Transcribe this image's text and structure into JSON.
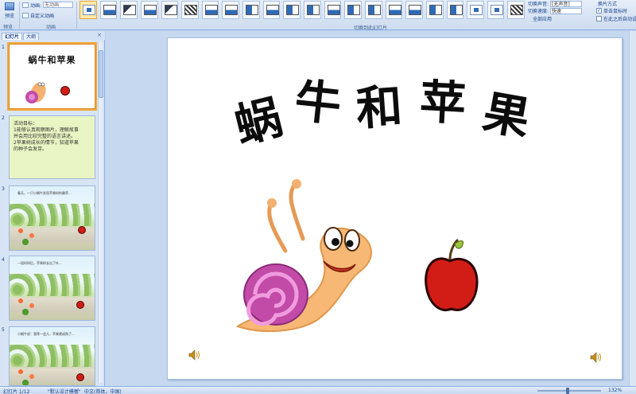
{
  "ribbon": {
    "preview_label": "预览",
    "group_preview": "预览",
    "animation": {
      "row1_label": "动画:",
      "row1_value": "无动画",
      "custom_label": "自定义动画",
      "group_label": "动画"
    },
    "transition_group_label": "切换到此幻灯片",
    "transitions": [
      {
        "name": "none"
      },
      {
        "name": "fade-smooth"
      },
      {
        "name": "fade-black"
      },
      {
        "name": "cut"
      },
      {
        "name": "cut-black"
      },
      {
        "name": "dissolve"
      },
      {
        "name": "wipe-down"
      },
      {
        "name": "wipe-left"
      },
      {
        "name": "wipe-right"
      },
      {
        "name": "wipe-up"
      },
      {
        "name": "split"
      },
      {
        "name": "split-vertical"
      },
      {
        "name": "reveal-down"
      },
      {
        "name": "reveal-left"
      },
      {
        "name": "reveal-right"
      },
      {
        "name": "reveal-up"
      },
      {
        "name": "cover-down"
      },
      {
        "name": "cover-left"
      },
      {
        "name": "cover-right"
      },
      {
        "name": "box-in"
      },
      {
        "name": "box-out"
      },
      {
        "name": "diamond"
      }
    ],
    "right": {
      "sound_label": "切换声音:",
      "sound_value": "[无声音]",
      "speed_label": "切换速度:",
      "speed_value": "快速",
      "apply_all": "全部应用",
      "advance_header": "换片方式",
      "on_click": "单击鼠标时",
      "after_auto": "在此之后自动设置"
    }
  },
  "left_panel": {
    "tabs": [
      "幻灯片",
      "大纲"
    ],
    "close": "×",
    "slides": [
      {
        "num": "1",
        "title": "蜗牛和苹果"
      },
      {
        "num": "2",
        "lines": [
          "活动目标：",
          "1能够认真观察图片，理解故事",
          "  并会用比较完整的语言讲述。",
          "2苹果树成长的情节，知道苹果",
          "  的种子会发芽。"
        ]
      },
      {
        "num": "3",
        "caption": "春天，一只小蜗牛发现苹果树的嫩芽..."
      },
      {
        "num": "4",
        "caption": "一段时间后，苹果树长出了叶..."
      },
      {
        "num": "5",
        "caption": "小蜗牛说：我等一会儿，苹果就成熟了..."
      }
    ]
  },
  "slide": {
    "title_chars": [
      "蜗",
      "牛",
      "和",
      "苹",
      "果"
    ]
  },
  "status": {
    "slide_info": "幻灯片 1/12",
    "theme": "\"默认设计模板\"",
    "lang": "中文(简体，中国)",
    "zoom": "132%"
  },
  "colors": {
    "apple": "#d21d17",
    "snail_shell": "#c24ba8",
    "snail_body": "#f4b070",
    "selection": "#f3a83a"
  }
}
